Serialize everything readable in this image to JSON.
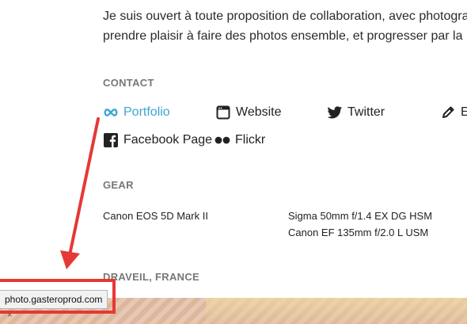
{
  "intro": {
    "line1": "Je suis ouvert à toute proposition de collaboration, avec photographes",
    "line2": "prendre plaisir à faire des photos ensemble, et progresser par la"
  },
  "contact": {
    "title": "CONTACT",
    "links": [
      {
        "label": "Portfolio",
        "icon": "infinity-icon"
      },
      {
        "label": "Website",
        "icon": "browser-window-icon"
      },
      {
        "label": "Twitter",
        "icon": "twitter-bird-icon"
      },
      {
        "label": "E",
        "icon": "pencil-icon"
      },
      {
        "label": "Facebook Page",
        "icon": "facebook-icon"
      },
      {
        "label": "Flickr",
        "icon": "flickr-dots-icon"
      }
    ]
  },
  "gear": {
    "title": "GEAR",
    "body": "Canon EOS 5D Mark II",
    "lenses": [
      "Sigma 50mm f/1.4 EX DG HSM",
      "Canon EF 135mm f/2.0 L USM"
    ]
  },
  "location": {
    "title": "DRAVEIL, FRANCE"
  },
  "status_bar": {
    "url": "photo.gasteroprod.com",
    "close": "×"
  },
  "colors": {
    "accent": "#3aa6d0",
    "annotation": "#e53935",
    "section_title": "#777777"
  }
}
